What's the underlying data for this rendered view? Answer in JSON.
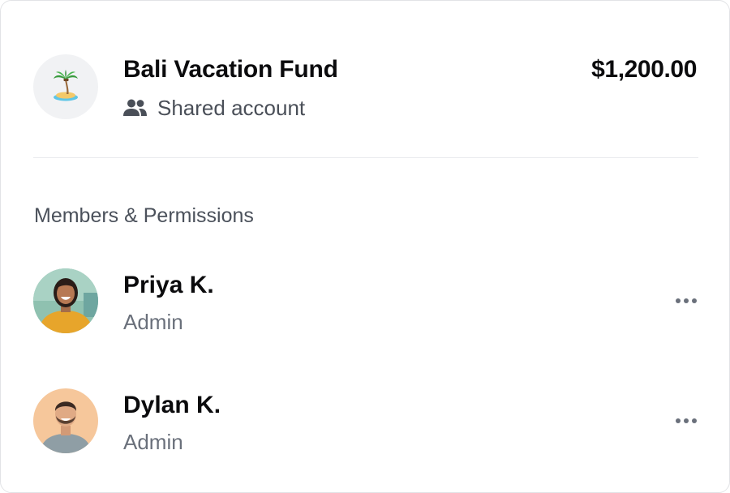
{
  "account": {
    "name": "Bali Vacation Fund",
    "type_label": "Shared account",
    "balance": "$1,200.00",
    "icon": "palm-tree-island-icon"
  },
  "members_section": {
    "title": "Members & Permissions",
    "members": [
      {
        "name": "Priya K.",
        "role": "Admin",
        "avatar": "avatar-photo",
        "more_icon": "more-horizontal-icon"
      },
      {
        "name": "Dylan K.",
        "role": "Admin",
        "avatar": "avatar-photo",
        "more_icon": "more-horizontal-icon"
      }
    ]
  },
  "colors": {
    "primary_text": "#0b0b0d",
    "secondary_text": "#4a4f58",
    "muted_text": "#6a707b",
    "avatar_bg": "#f1f2f4",
    "divider": "#e9eaed"
  }
}
